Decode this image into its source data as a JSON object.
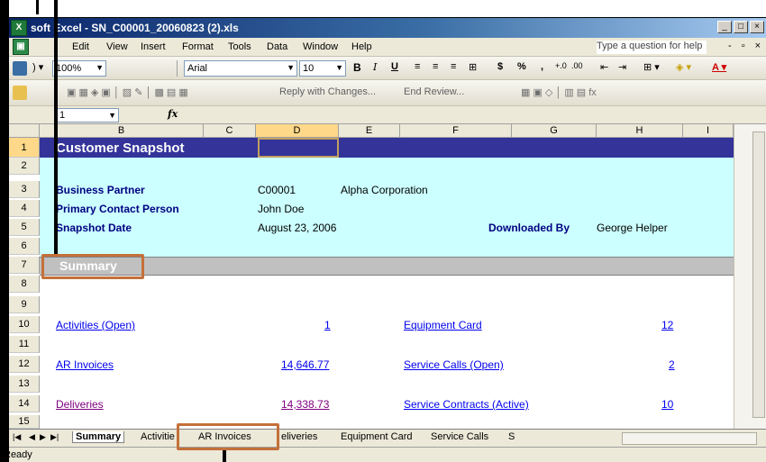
{
  "window": {
    "title": "soft Excel - SN_C00001_20060823 (2).xls",
    "app_icon": "excel-icon"
  },
  "menu": [
    "Edit",
    "View",
    "Insert",
    "Format",
    "Tools",
    "Data",
    "Window",
    "Help"
  ],
  "help": {
    "placeholder": "Type a question for help"
  },
  "toolbar1": {
    "zoom": "100%",
    "font": "Arial",
    "size": "10",
    "bold": "B",
    "italic": "I",
    "underline": "U",
    "currency": "$",
    "percent": "%",
    "comma": ","
  },
  "toolbar2": {
    "reply": "Reply with Changes...",
    "end_review": "End Review..."
  },
  "formula": {
    "name_box": "1",
    "fx": "fx"
  },
  "columns": [
    "B",
    "C",
    "D",
    "E",
    "F",
    "G",
    "H",
    "I"
  ],
  "rows": [
    "1",
    "2",
    "3",
    "4",
    "5",
    "6",
    "7",
    "8",
    "9",
    "10",
    "11",
    "12",
    "13",
    "14",
    "15"
  ],
  "sheet": {
    "title": "Customer Snapshot",
    "partner_label": "Business Partner",
    "partner_code": "C00001",
    "partner_name": "Alpha Corporation",
    "contact_label": "Primary Contact Person",
    "contact_value": "John Doe",
    "date_label": "Snapshot Date",
    "date_value": "August 23, 2006",
    "downloaded_label": "Downloaded By",
    "downloaded_value": "George Helper",
    "summary": "Summary",
    "links": {
      "activities": "Activities (Open)",
      "activities_val": "1",
      "equipment": "Equipment Card",
      "equipment_val": "12",
      "ar": "AR Invoices",
      "ar_val": "14,646.77",
      "service_calls": "Service Calls (Open)",
      "service_calls_val": "2",
      "deliveries": "Deliveries",
      "deliveries_val": "14,338.73",
      "contracts": "Service Contracts (Active)",
      "contracts_val": "10"
    }
  },
  "tabs": [
    "Summary",
    "Activities",
    "AR Invoices",
    "Deliveries",
    "Equipment Card",
    "Service Calls",
    "S"
  ],
  "tab_display": {
    "deliveries": "eliveries",
    "activities": "Activitie"
  },
  "status": {
    "text": "Ready"
  },
  "colors": {
    "title_bg": "#333399",
    "cyan_bg": "#ccffff",
    "summary_bg": "#c0c0c0",
    "callout": "#c4703a"
  }
}
